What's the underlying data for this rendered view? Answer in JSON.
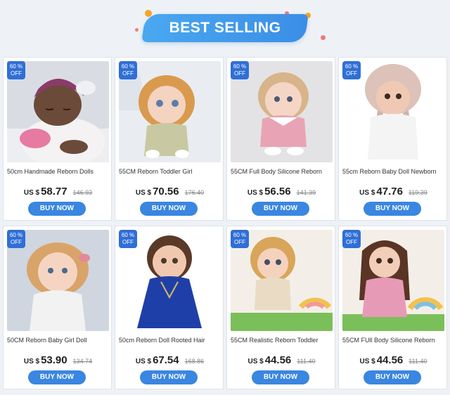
{
  "header": {
    "title": "BEST SELLING"
  },
  "badge": {
    "line1": "60 %",
    "line2": "OFF"
  },
  "products": [
    {
      "title": "50cm Handmade Reborn Dolls",
      "currency": "US $",
      "price": "58.77",
      "old_price": "146.93",
      "button": "BUY NOW"
    },
    {
      "title": "55CM Reborn Toddler Girl",
      "currency": "US $",
      "price": "70.56",
      "old_price": "176.40",
      "button": "BUY NOW"
    },
    {
      "title": "55CM Full Body Silicone Reborn",
      "currency": "US $",
      "price": "56.56",
      "old_price": "141.39",
      "button": "BUY NOW"
    },
    {
      "title": "55cm Reborn Baby Doll Newborn",
      "currency": "US $",
      "price": "47.76",
      "old_price": "119.39",
      "button": "BUY NOW"
    },
    {
      "title": "50CM  Reborn Baby Girl Doll",
      "currency": "US $",
      "price": "53.90",
      "old_price": "134.74",
      "button": "BUY NOW"
    },
    {
      "title": "50cm Reborn Doll Rooted Hair",
      "currency": "US $",
      "price": "67.54",
      "old_price": "168.86",
      "button": "BUY NOW"
    },
    {
      "title": "55CM Realistic Reborn Toddler",
      "currency": "US $",
      "price": "44.56",
      "old_price": "111.40",
      "button": "BUY NOW"
    },
    {
      "title": "55CM  FUll Body Silicone Reborn",
      "currency": "US $",
      "price": "44.56",
      "old_price": "111.40",
      "button": "BUY NOW"
    }
  ]
}
